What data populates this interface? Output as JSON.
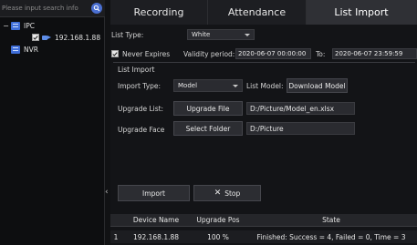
{
  "search": {
    "placeholder": "Please input search info"
  },
  "tree": {
    "ipc_label": "IPC",
    "device_label": "192.168.1.88",
    "nvr_label": "NVR"
  },
  "tabs": [
    {
      "label": "Recording"
    },
    {
      "label": "Attendance"
    },
    {
      "label": "List Import"
    }
  ],
  "form": {
    "list_type_label": "List Type:",
    "list_type_value": "White",
    "never_expires_label": "Never Expires",
    "validity_label": "Validity period:",
    "validity_from": "2020-06-07 00:00:00",
    "to_label": "To:",
    "validity_to": "2020-06-07 23:59:59"
  },
  "import": {
    "section_title": "List Import",
    "import_type_label": "Import Type:",
    "import_type_value": "Model",
    "list_model_label": "List Model:",
    "download_model_label": "Download Model",
    "upgrade_list_label": "Upgrade List:",
    "upgrade_file_label": "Upgrade File",
    "upgrade_file_path": "D:/Picture/Model_en.xlsx",
    "upgrade_face_label": "Upgrade Face",
    "select_folder_label": "Select Folder",
    "face_folder_path": "D:/Picture",
    "import_button": "Import",
    "stop_button": "Stop"
  },
  "table": {
    "headers": [
      "Device Name",
      "Upgrade Pos",
      "State"
    ],
    "rows": [
      {
        "index": "1",
        "device": "192.168.1.88",
        "pos": "100 %",
        "state": "Finished: Success = 4, Failed = 0, Time = 3"
      }
    ]
  },
  "colors": {
    "accent": "#4a6fd1",
    "active_tab": "#2f3035"
  }
}
